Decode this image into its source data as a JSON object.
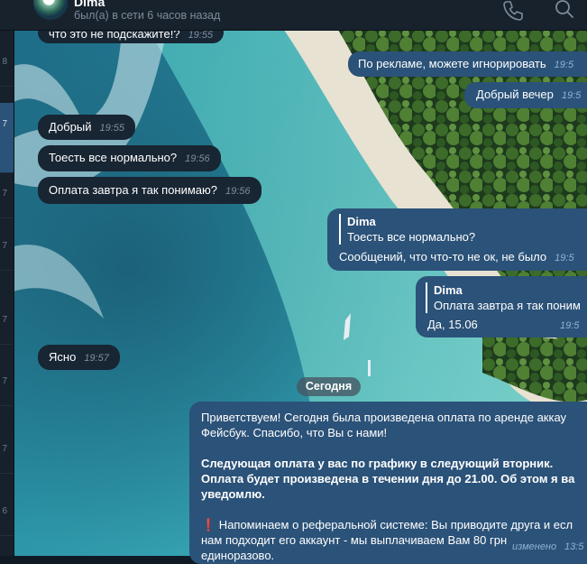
{
  "header": {
    "name": "Dima",
    "status": "был(а) в сети 6 часов назад"
  },
  "sidebar": {
    "counts": [
      "8",
      "7",
      "7",
      "7",
      "7",
      "7",
      "7",
      "6"
    ]
  },
  "date_divider": "Сегодня",
  "messages": {
    "m1": {
      "text": "что это не подскажите!?",
      "time": "19:55"
    },
    "m2": {
      "text": "По рекламе, можете игнорировать",
      "time": "19:5"
    },
    "m3": {
      "text": "Добрый вечер",
      "time": "19:5"
    },
    "m4": {
      "text": "Добрый",
      "time": "19:55"
    },
    "m5": {
      "text": "Тоесть все нормально?",
      "time": "19:56"
    },
    "m6": {
      "text": "Оплата завтра я так понимаю?",
      "time": "19:56"
    },
    "m7": {
      "reply_name": "Dima",
      "reply_text": "Тоесть все нормально?",
      "text": "Сообщений, что что-то не ок, не было",
      "time": "19:5"
    },
    "m8": {
      "reply_name": "Dima",
      "reply_text": "Оплата завтра я так поним",
      "text": "Да, 15.06",
      "time": "19:5"
    },
    "m9": {
      "text": "Ясно",
      "time": "19:57"
    },
    "m10": {
      "line1": "Приветствуем! Сегодня была произведена оплата по аренде аккау",
      "line2": "Фейсбук. Спасибо, что Вы с нами!",
      "line3": "Следующая оплата у вас по графику в следующий вторник.",
      "line4": "Оплата будет произведена в течении дня до 21.00. Об этом я ва",
      "line5": "уведомлю.",
      "warn_icon": "❗",
      "line6": " Напоминаем о реферальной системе: Вы приводите друга и есл",
      "line7": "нам подходит его аккаунт - мы выплачиваем Вам 80 грн",
      "line8": "единоразово.",
      "edited": "изменено",
      "time": "13:5"
    }
  },
  "icons": {
    "header_phone": "phone-icon",
    "header_search": "search-icon"
  },
  "colors": {
    "outgoing": "#2b5278",
    "incoming": "#182533",
    "header": "#18222d"
  }
}
